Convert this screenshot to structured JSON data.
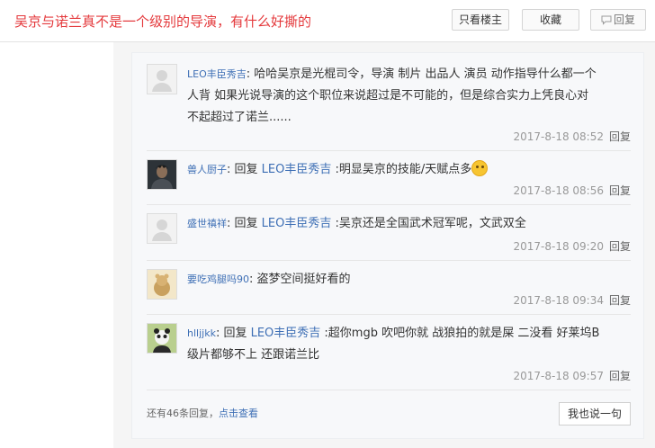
{
  "header": {
    "title": "吴京与诺兰真不是一个级别的导演，有什么好撕的",
    "only_op_label": "只看楼主",
    "favorite_label": "收藏",
    "reply_label": "回复"
  },
  "replies": [
    {
      "username": "LEO丰臣秀吉",
      "separator": ": ",
      "text_line1": "哈哈吴京是光棍司令，导演 制片 出品人 演员 动作指导什么都一个",
      "text_line2": "人背 如果光说导演的这个职位来说超过是不可能的，但是综合实力上凭良心对",
      "text_line3": "不起超过了诺兰......",
      "time": "2017-8-18 08:52",
      "reply_label": "回复"
    },
    {
      "username": "兽人厨子",
      "prefix": ": 回复 ",
      "mention": "LEO丰臣秀吉",
      "text": " :明显吴京的技能/天赋点多",
      "time": "2017-8-18 08:56",
      "reply_label": "回复"
    },
    {
      "username": "盛世禛祥",
      "prefix": ": 回复 ",
      "mention": "LEO丰臣秀吉",
      "text": " :吴京还是全国武术冠军呢，文武双全",
      "time": "2017-8-18 09:20",
      "reply_label": "回复"
    },
    {
      "username": "要吃鸡腿吗90",
      "separator": ": ",
      "text": "盗梦空间挺好看的",
      "time": "2017-8-18 09:34",
      "reply_label": "回复"
    },
    {
      "username": "hlljjkk",
      "prefix": ": 回复 ",
      "mention": "LEO丰臣秀吉",
      "text_line1": " :超你mgb 吹吧你就 战狼拍的就是屎 二没看 好莱坞B",
      "text_line2": "级片都够不上 还跟诺兰比",
      "time": "2017-8-18 09:57",
      "reply_label": "回复"
    }
  ],
  "footer": {
    "more_prefix": "还有46条回复，",
    "more_link": "点击查看",
    "say_button": "我也说一句"
  }
}
